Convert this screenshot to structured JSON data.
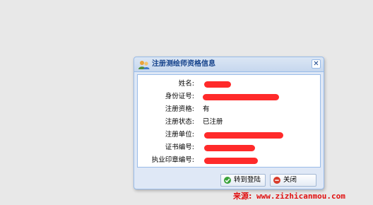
{
  "dialog": {
    "title": "注册测绘师资格信息",
    "close_glyph": "✕"
  },
  "fields": [
    {
      "label": "姓名:",
      "value": "",
      "redacted": true
    },
    {
      "label": "身份证号:",
      "value": "",
      "redacted": true
    },
    {
      "label": "注册资格:",
      "value": "有",
      "redacted": false
    },
    {
      "label": "注册状态:",
      "value": "已注册",
      "redacted": false
    },
    {
      "label": "注册单位:",
      "value": "",
      "redacted": true
    },
    {
      "label": "证书编号:",
      "value": "",
      "redacted": true
    },
    {
      "label": "执业印章编号:",
      "value": "",
      "redacted": true
    }
  ],
  "buttons": {
    "goto_login": "转到登陆",
    "close": "关闭"
  },
  "watermark": {
    "label": "来源:",
    "url": "www.zizhicanmou.com"
  },
  "colors": {
    "redaction": "#ff2a2a",
    "title_text": "#15428b",
    "watermark": "#e01010",
    "ok_icon": "#3aa33a",
    "close_icon": "#d83a2a"
  },
  "icons": {
    "title": "users-group-icon",
    "goto_login": "check-circle-icon",
    "close": "minus-circle-icon"
  }
}
